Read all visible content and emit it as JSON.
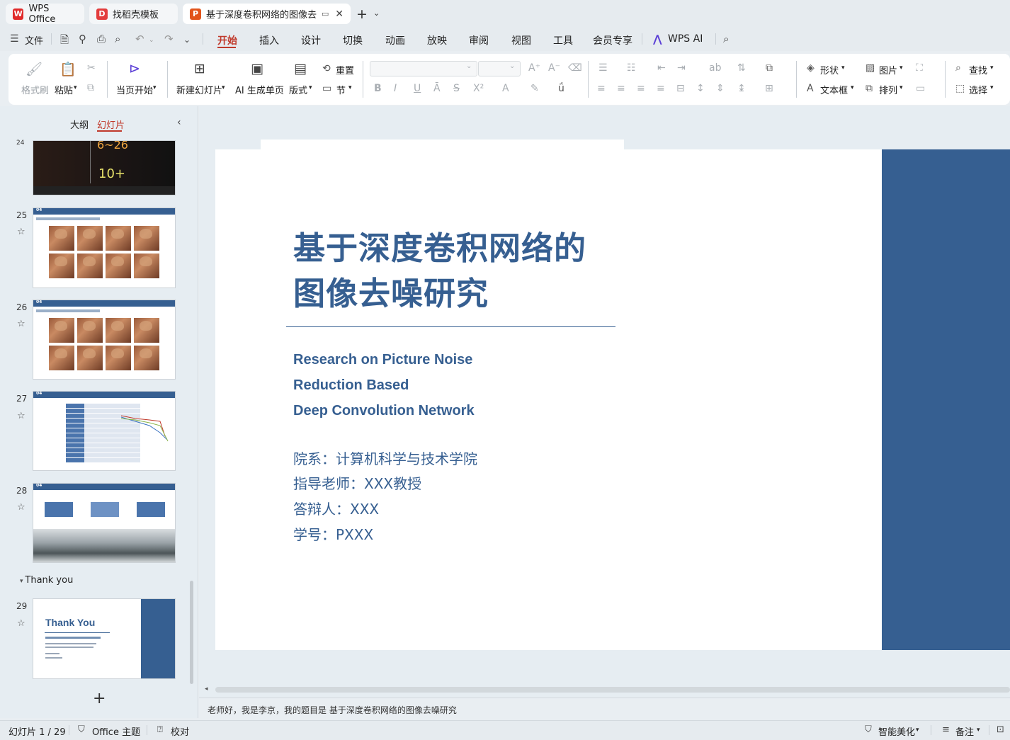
{
  "tabs": [
    {
      "label": "WPS Office",
      "logo": "W",
      "logo_color": "#e02a2a"
    },
    {
      "label": "找稻壳模板",
      "logo": "D",
      "logo_color": "#e33d3d"
    },
    {
      "label": "基于深度卷积网络的图像去噪",
      "logo": "P",
      "logo_color": "#e2541b"
    }
  ],
  "menu": {
    "file_label": "文件",
    "items": [
      "开始",
      "插入",
      "设计",
      "切换",
      "动画",
      "放映",
      "审阅",
      "视图",
      "工具",
      "会员专享"
    ],
    "active": "开始",
    "wps_ai": "WPS AI"
  },
  "ribbon": {
    "format_painter": "格式刷",
    "paste": "粘贴",
    "play_from_current": "当页开始",
    "new_slide": "新建幻灯片",
    "ai_generate": "AI 生成单页",
    "layout": "版式",
    "reset": "重置",
    "section": "节",
    "shape": "形状",
    "picture": "图片",
    "textbox": "文本框",
    "arrange": "排列",
    "find": "查找",
    "select": "选择"
  },
  "left_panel": {
    "tab_outline": "大纲",
    "tab_slides": "幻灯片",
    "slides": [
      {
        "num": "24",
        "stat1": "6~26",
        "stat2": "10+"
      },
      {
        "num": "25",
        "section_tag": "04"
      },
      {
        "num": "26",
        "section_tag": "04"
      },
      {
        "num": "27",
        "section_tag": "04"
      },
      {
        "num": "28",
        "section_tag": "04"
      },
      {
        "num": "29",
        "title": "Thank You"
      }
    ],
    "section_name": "Thank you"
  },
  "slide": {
    "title_line1": "基于深度卷积网络的",
    "title_line2": "图像去噪研究",
    "en_line1": "Research on Picture Noise",
    "en_line2": "Reduction Based",
    "en_line3": "Deep Convolution Network",
    "info": [
      "院系：计算机科学与技术学院",
      "指导老师：XXX教授",
      "答辩人：XXX",
      "学号：PXXX"
    ],
    "accent_color": "#365f91"
  },
  "notes": "老师好，我是李京，我的题目是 基于深度卷积网络的图像去噪研究",
  "status": {
    "slide_indicator": "幻灯片 1 / 29",
    "theme": "Office 主题",
    "proofread": "校对",
    "smart_beautify": "智能美化",
    "notes_label": "备注"
  }
}
